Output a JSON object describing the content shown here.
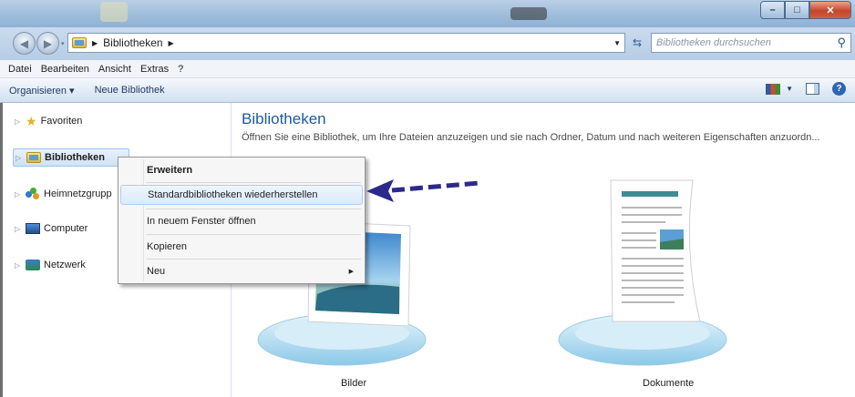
{
  "window": {
    "colors": {
      "title_gradient": "#a3c0dc",
      "close": "#c5452c"
    }
  },
  "address": {
    "crumb": "Bibliotheken",
    "search_placeholder": "Bibliotheken durchsuchen"
  },
  "menubar": {
    "items": [
      "Datei",
      "Bearbeiten",
      "Ansicht",
      "Extras",
      "?"
    ]
  },
  "commandbar": {
    "organize": "Organisieren ▾",
    "new_library": "Neue Bibliothek"
  },
  "sidebar": {
    "items": [
      {
        "label": "Favoriten",
        "icon": "star-icon"
      },
      {
        "label": "Bibliotheken",
        "icon": "library-icon"
      },
      {
        "label": "Heimnetzgrupp",
        "icon": "homegroup-icon"
      },
      {
        "label": "Computer",
        "icon": "computer-icon"
      },
      {
        "label": "Netzwerk",
        "icon": "network-icon"
      }
    ]
  },
  "content": {
    "title": "Bibliotheken",
    "subtitle": "Öffnen Sie eine Bibliothek, um Ihre Dateien anzuzeigen und sie nach Ordner, Datum und nach weiteren Eigenschaften anzuordn...",
    "libraries": [
      {
        "label": "Bilder"
      },
      {
        "label": "Dokumente"
      }
    ]
  },
  "context_menu": {
    "items": [
      {
        "label": "Erweitern"
      },
      {
        "label": "Standardbibliotheken wiederherstellen"
      },
      {
        "label": "In neuem Fenster öffnen"
      },
      {
        "label": "Kopieren"
      },
      {
        "label": "Neu"
      }
    ]
  },
  "annotation": {
    "color": "#2b2a8c"
  }
}
